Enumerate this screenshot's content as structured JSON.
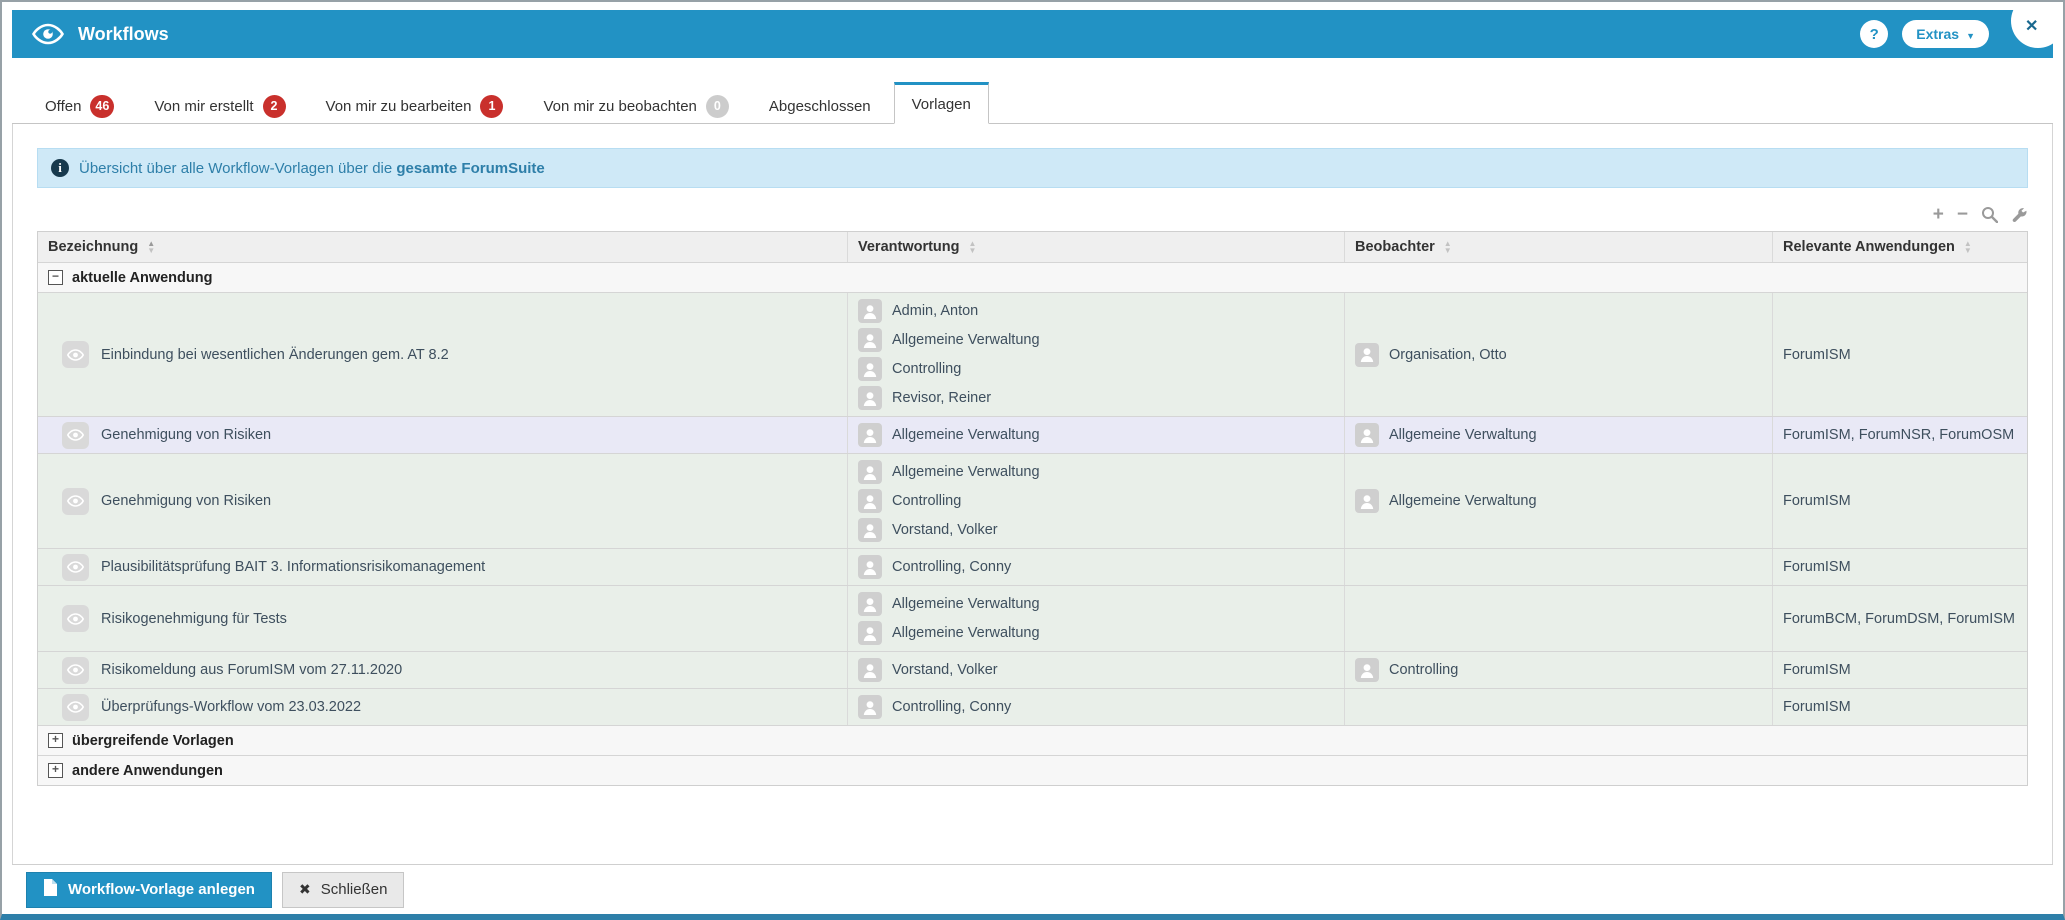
{
  "window": {
    "title": "Workflows",
    "help_button": "?",
    "extras_button": "Extras",
    "close_button": "✕"
  },
  "tabs": [
    {
      "label": "Offen",
      "badge": "46",
      "badge_color": "red",
      "active": false
    },
    {
      "label": "Von mir erstellt",
      "badge": "2",
      "badge_color": "red",
      "active": false
    },
    {
      "label": "Von mir zu bearbeiten",
      "badge": "1",
      "badge_color": "red",
      "active": false
    },
    {
      "label": "Von mir zu beobachten",
      "badge": "0",
      "badge_color": "gray",
      "active": false
    },
    {
      "label": "Abgeschlossen",
      "badge": null,
      "active": false
    },
    {
      "label": "Vorlagen",
      "badge": null,
      "active": true
    }
  ],
  "info_bar": {
    "text": "Übersicht über alle Workflow-Vorlagen über die ",
    "text_bold": "gesamte ForumSuite"
  },
  "table_toolbar": {
    "icons": [
      "plus-icon",
      "minus-icon",
      "search-icon",
      "wrench-icon"
    ]
  },
  "table": {
    "columns": [
      "Bezeichnung",
      "Verantwortung",
      "Beobachter",
      "Relevante Anwendungen"
    ],
    "sorted_column": "Bezeichnung",
    "groups": [
      {
        "label": "aktuelle Anwendung",
        "state": "expanded",
        "rows": [
          {
            "bezeichnung": "Einbindung bei wesentlichen Änderungen gem. AT 8.2",
            "verantwortung": [
              "Admin, Anton",
              "Allgemeine Verwaltung",
              "Controlling",
              "Revisor, Reiner"
            ],
            "beobachter": [
              "Organisation, Otto"
            ],
            "anwendungen": "ForumISM",
            "highlighted": false
          },
          {
            "bezeichnung": "Genehmigung von Risiken",
            "verantwortung": [
              "Allgemeine Verwaltung"
            ],
            "beobachter": [
              "Allgemeine Verwaltung"
            ],
            "anwendungen": "ForumISM, ForumNSR, ForumOSM",
            "highlighted": true
          },
          {
            "bezeichnung": "Genehmigung von Risiken",
            "verantwortung": [
              "Allgemeine Verwaltung",
              "Controlling",
              "Vorstand, Volker"
            ],
            "beobachter": [
              "Allgemeine Verwaltung"
            ],
            "anwendungen": "ForumISM",
            "highlighted": false
          },
          {
            "bezeichnung": "Plausibilitätsprüfung BAIT 3. Informationsrisikomanagement",
            "verantwortung": [
              "Controlling, Conny"
            ],
            "beobachter": [],
            "anwendungen": "ForumISM",
            "highlighted": false
          },
          {
            "bezeichnung": "Risikogenehmigung für Tests",
            "verantwortung": [
              "Allgemeine Verwaltung",
              "Allgemeine Verwaltung"
            ],
            "beobachter": [],
            "anwendungen": "ForumBCM, ForumDSM, ForumISM",
            "highlighted": false
          },
          {
            "bezeichnung": "Risikomeldung aus ForumISM vom 27.11.2020",
            "verantwortung": [
              "Vorstand, Volker"
            ],
            "beobachter": [
              "Controlling"
            ],
            "anwendungen": "ForumISM",
            "highlighted": false
          },
          {
            "bezeichnung": "Überprüfungs-Workflow vom 23.03.2022",
            "verantwortung": [
              "Controlling, Conny"
            ],
            "beobachter": [],
            "anwendungen": "ForumISM",
            "highlighted": false
          }
        ]
      },
      {
        "label": "übergreifende Vorlagen",
        "state": "collapsed",
        "rows": []
      },
      {
        "label": "andere Anwendungen",
        "state": "collapsed",
        "rows": []
      }
    ]
  },
  "footer": {
    "create_button": "Workflow-Vorlage anlegen",
    "close_button": "Schließen"
  },
  "colors": {
    "accent_blue": "#2292c4",
    "badge_red": "#c9302c",
    "badge_gray": "#cccccc",
    "row_green": "#e9efe9",
    "row_highlight": "#e9e9f6",
    "info_bg": "#cfe9f7",
    "info_text": "#2e7fa9"
  }
}
